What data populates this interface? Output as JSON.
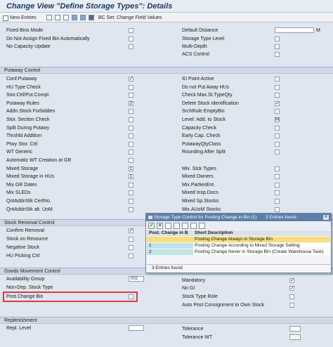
{
  "title": "Change View \"Define Storage Types\": Details",
  "toolbar": {
    "new_entries": "New Entries",
    "bc_set": "BC Set: Change Field Values"
  },
  "top": {
    "left": [
      {
        "label": "Fixed Bins Mode",
        "checked": false
      },
      {
        "label": "Do Not Assign Fixed Bin Automatically",
        "checked": false
      },
      {
        "label": "No Capacity Update",
        "checked": false
      }
    ],
    "right": [
      {
        "label": "Default Distance",
        "value": "",
        "unit": "M"
      },
      {
        "label": "Storage Type Level",
        "checked": false
      },
      {
        "label": "Multi-Depth",
        "checked": false
      },
      {
        "label": "ACS Control",
        "checked": false
      }
    ]
  },
  "putaway": {
    "heading": "Putaway Control",
    "left": [
      {
        "label": "Conf.Putaway",
        "value": "✓"
      },
      {
        "label": "HU Type Check",
        "value": ""
      },
      {
        "label": "Stor.Ctrl/Put.Compl.",
        "value": ""
      },
      {
        "label": "Putaway Rules",
        "value": "2"
      },
      {
        "label": "Addn.Stock Forbidden",
        "value": ""
      },
      {
        "label": "Stor. Section Check",
        "value": ""
      },
      {
        "label": "Split During Putawy",
        "value": ""
      },
      {
        "label": "Thrshld Addition",
        "value": ""
      },
      {
        "label": "Ptwy Stor. Ctrl",
        "value": ""
      },
      {
        "label": "WT Generic",
        "value": ""
      },
      {
        "label": "Automatic WT Creation at GR",
        "value": ""
      },
      {
        "label": "Mixed Storage",
        "value": "1"
      },
      {
        "label": "Mixed Storage in HUs",
        "value": "1"
      },
      {
        "label": "Mix GR Dates",
        "value": ""
      },
      {
        "label": "Mix SLEDs",
        "value": ""
      },
      {
        "label": "QntAddnStk CertNo.",
        "value": ""
      },
      {
        "label": "QntAddnStk alt. UoM.",
        "value": ""
      }
    ],
    "right": [
      {
        "label": "ID Point Active",
        "value": ""
      },
      {
        "label": "Do not Put Away HUs",
        "value": ""
      },
      {
        "label": "Check Max.St.TypeQty",
        "value": ""
      },
      {
        "label": "Delete Stock Identification",
        "value": "✓"
      },
      {
        "label": "SrchRule EmptyBin",
        "value": ""
      },
      {
        "label": "Level: Add. to Stock",
        "value": "H"
      },
      {
        "label": "Capacity Check",
        "value": ""
      },
      {
        "label": "Early Cap. Check",
        "value": ""
      },
      {
        "label": "PutawayQtyClass",
        "value": ""
      },
      {
        "label": "Rounding After Split",
        "value": ""
      },
      {
        "label": "",
        "value": ""
      },
      {
        "label": "Mix. Stck Types",
        "value": ""
      },
      {
        "label": "Mixed Owners",
        "value": ""
      },
      {
        "label": "Mix.PartiesEnt.",
        "value": ""
      },
      {
        "label": "Mixed Insp.Docs",
        "value": ""
      },
      {
        "label": "Mixed Sp.Stocks",
        "value": ""
      },
      {
        "label": "Mix.AUoM Stocks",
        "value": ""
      }
    ]
  },
  "removal": {
    "heading": "Stock Removal Control",
    "left": [
      {
        "label": "Confirm Removal",
        "value": "✓"
      },
      {
        "label": "Stock on Resource",
        "value": ""
      },
      {
        "label": "Negative Stock",
        "value": ""
      },
      {
        "label": "HU Picking Ctrl",
        "value": ""
      }
    ]
  },
  "goods": {
    "heading": "Goods Movement Control",
    "left": [
      {
        "label": "Availability Group",
        "value": "002"
      },
      {
        "label": "Non-Dep. Stock Type",
        "value": ""
      },
      {
        "label": "Post.Change Bin",
        "value": ""
      }
    ],
    "right": [
      {
        "label": "Mandatory",
        "value": "✓"
      },
      {
        "label": "No GI",
        "value": "✓"
      },
      {
        "label": "Stock Type Role",
        "value": ""
      },
      {
        "label": "Auto Post Consignment to Own Stock",
        "value": ""
      }
    ]
  },
  "replenish": {
    "heading": "Replenishment",
    "left": [
      {
        "label": "Repl. Level",
        "value": ""
      }
    ],
    "right": [
      {
        "label": "Tolerance",
        "value": ""
      },
      {
        "label": "Tolerance WT",
        "value": ""
      }
    ]
  },
  "popup": {
    "title": "Storage Type Control for Posting Change in Bin (1)",
    "count_label": "3 Entries found",
    "col1": "Post. Change in B",
    "col2": "Short Description",
    "rows": [
      {
        "key": "",
        "desc": "Posting Change Always in Storage Bin"
      },
      {
        "key": "1",
        "desc": "Posting Change According to Mixed Storage Setting"
      },
      {
        "key": "2",
        "desc": "Posting Change Never in Storage Bin (Create Warehouse Task)"
      }
    ],
    "footer": "3 Entries found"
  }
}
